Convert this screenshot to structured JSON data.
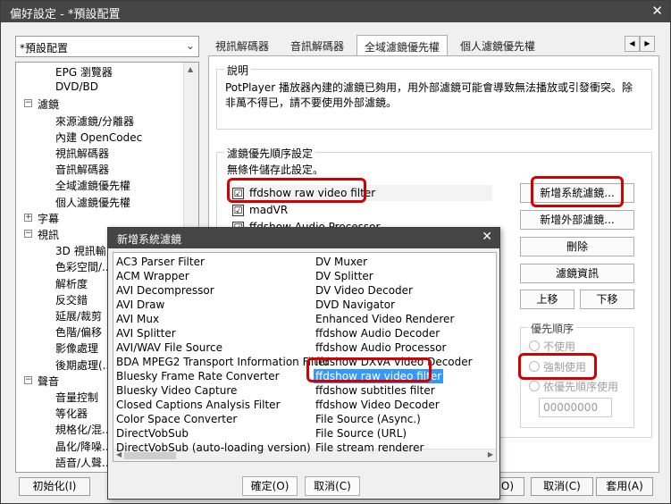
{
  "window": {
    "title": "偏好設定 - *預設配置",
    "close": "✕"
  },
  "preset": {
    "value": "*預設配置"
  },
  "tree": {
    "items": [
      {
        "label": "EPG 瀏覽器"
      },
      {
        "label": "DVD/BD"
      },
      {
        "label": "濾鏡",
        "expander": "−"
      },
      {
        "label": "來源濾鏡/分離器"
      },
      {
        "label": "內建 OpenCodec"
      },
      {
        "label": "視訊解碼器"
      },
      {
        "label": "音訊解碼器"
      },
      {
        "label": "全域濾鏡優先權"
      },
      {
        "label": "個人濾鏡優先權"
      },
      {
        "label": "字幕",
        "expander": "+"
      },
      {
        "label": "視訊",
        "expander": "−"
      },
      {
        "label": "3D 視訊輸..."
      },
      {
        "label": "色彩空間/..."
      },
      {
        "label": "解析度"
      },
      {
        "label": "反交錯"
      },
      {
        "label": "延展/裁剪"
      },
      {
        "label": "色階/偏移"
      },
      {
        "label": "影像處理"
      },
      {
        "label": "後期處理(..."
      },
      {
        "label": "聲音",
        "expander": "−"
      },
      {
        "label": "音量控制"
      },
      {
        "label": "等化器"
      },
      {
        "label": "規格化/混..."
      },
      {
        "label": "晶化/降噪..."
      },
      {
        "label": "語音/人聲..."
      }
    ]
  },
  "tabs": [
    {
      "label": "視訊解碼器"
    },
    {
      "label": "音訊解碼器"
    },
    {
      "label": "全域濾鏡優先權"
    },
    {
      "label": "個人濾鏡優先權"
    }
  ],
  "tab_nav": {
    "prev": "◀",
    "next": "▶"
  },
  "description": {
    "title": "說明",
    "text": "PotPlayer 播放器內建的濾鏡已夠用，用外部濾鏡可能會導致無法播放或引發衝突。除非萬不得已，請不要使用外部濾鏡。"
  },
  "priority": {
    "title": "濾鏡優先順序設定",
    "note": "無條件儲存此設定。",
    "filters": [
      {
        "label": "ffdshow raw video filter",
        "checked": "☑"
      },
      {
        "label": "madVR",
        "checked": "☑"
      },
      {
        "label": "ffdshow Audio Processor",
        "checked": "☑"
      }
    ],
    "buttons": {
      "add_system": "新增系統濾鏡...",
      "add_external": "新增外部濾鏡...",
      "delete": "刪除",
      "info": "濾鏡資訊",
      "up": "上移",
      "down": "下移"
    },
    "order": {
      "title": "優先順序",
      "options": [
        "不使用",
        "強制使用",
        "依優先順序使用"
      ],
      "number": "00000000"
    }
  },
  "bottom": {
    "init": "初始化(I)",
    "ok_partial": "O)",
    "cancel": "取消(C)",
    "apply": "套用(A)"
  },
  "dialog": {
    "title": "新增系統濾鏡",
    "close": "✕",
    "left_items": [
      "AC3 Parser Filter",
      "ACM Wrapper",
      "AVI Decompressor",
      "AVI Draw",
      "AVI Mux",
      "AVI Splitter",
      "AVI/WAV File Source",
      "BDA MPEG2 Transport Information Filter",
      "Bluesky Frame Rate Converter",
      "Bluesky Video Capture",
      "Closed Captions Analysis Filter",
      "Color Space Converter",
      "DirectVobSub",
      "DirectVobSub (auto-loading version)"
    ],
    "right_items": [
      "DV Muxer",
      "DV Splitter",
      "DV Video Decoder",
      "DVD Navigator",
      "Enhanced Video Renderer",
      "ffdshow Audio Decoder",
      "ffdshow Audio Processor",
      "ffdshow DXVA Video Decoder",
      "ffdshow raw video filter",
      "ffdshow subtitles filter",
      "ffdshow Video Decoder",
      "File Source (Async.)",
      "File Source (URL)",
      "File stream renderer"
    ],
    "selected_index": 8,
    "ok": "確定(O)",
    "cancel": "取消(C)",
    "scroll_left": "◀",
    "scroll_right": "▶"
  },
  "colors": {
    "titlebar": "#454545",
    "selection": "#3399ff",
    "highlight": "#d40000"
  }
}
